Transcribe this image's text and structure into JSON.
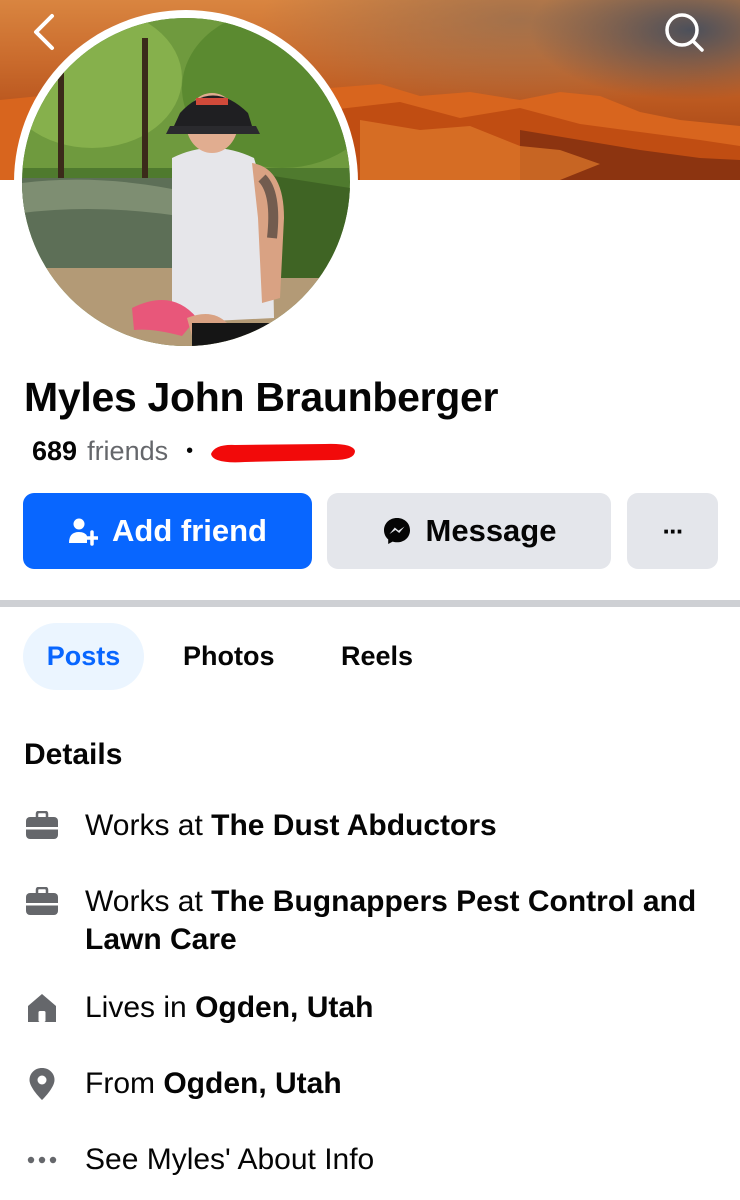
{
  "header": {
    "back_icon": "chevron-left-icon",
    "search_icon": "search-icon"
  },
  "profile": {
    "name": "Myles John Braunberger",
    "friends_count": "689",
    "friends_label": "friends",
    "separator": "•"
  },
  "actions": {
    "add_friend_label": "Add friend",
    "message_label": "Message",
    "more_label": "···"
  },
  "tabs": [
    {
      "label": "Posts",
      "active": true
    },
    {
      "label": "Photos",
      "active": false
    },
    {
      "label": "Reels",
      "active": false
    }
  ],
  "details": {
    "heading": "Details",
    "items": [
      {
        "icon": "briefcase-icon",
        "prefix": "Works at ",
        "value": "The Dust Abductors"
      },
      {
        "icon": "briefcase-icon",
        "prefix": "Works at ",
        "value": "The Bugnappers Pest Control and Lawn Care"
      },
      {
        "icon": "home-icon",
        "prefix": "Lives in ",
        "value": "Ogden, Utah"
      },
      {
        "icon": "location-pin-icon",
        "prefix": "From ",
        "value": "Ogden, Utah"
      },
      {
        "icon": "more-dots-icon",
        "prefix": "See Myles' About Info",
        "value": ""
      }
    ]
  },
  "colors": {
    "primary": "#0866ff",
    "secondary_button": "#e4e6eb",
    "active_tab_bg": "#ebf5ff",
    "muted_text": "#65676b",
    "redaction": "#f20a0a"
  }
}
